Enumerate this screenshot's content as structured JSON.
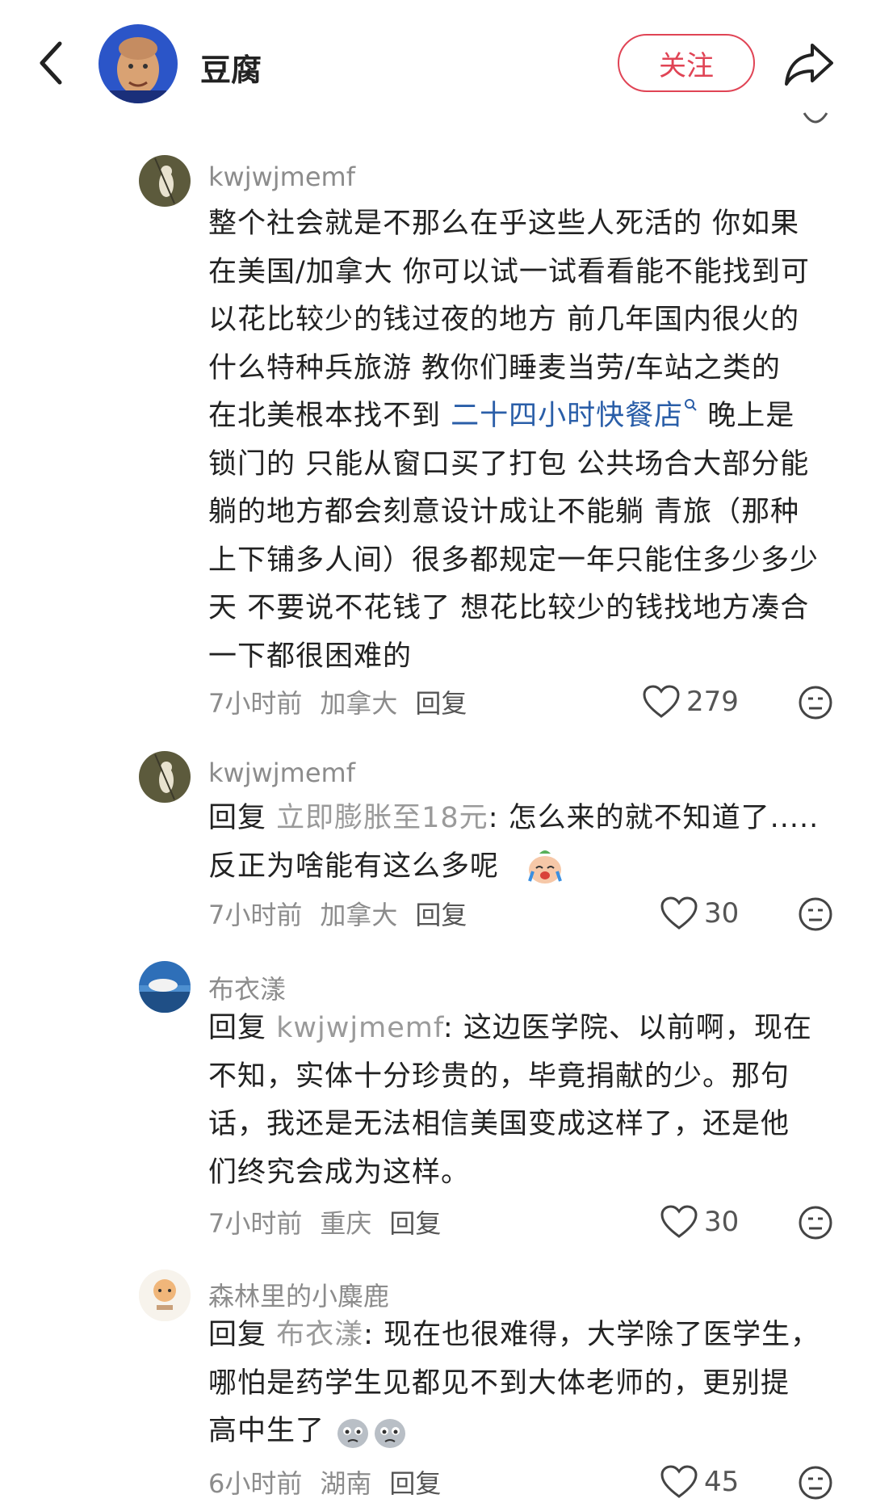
{
  "header": {
    "title": "豆腐",
    "follow_label": "关注"
  },
  "comments": [
    {
      "user": "kwjwjmemf",
      "text_lines": [
        "整个社会就是不那么在乎这些人死活的 你如果",
        "在美国/加拿大 你可以试一试看看能不能找到可",
        "以花比较少的钱过夜的地方 前几年国内很火的",
        "什么特种兵旅游 教你们睡麦当劳/车站之类的"
      ],
      "line5_before": "在北美根本找不到 ",
      "line5_link": "二十四小时快餐店",
      "line5_after": " 晚上是",
      "text_lines_2": [
        "锁门的 只能从窗口买了打包 公共场合大部分能",
        "躺的地方都会刻意设计成让不能躺 青旅（那种",
        "上下铺多人间）很多都规定一年只能住多少多少",
        "天 不要说不花钱了 想花比较少的钱找地方凑合",
        "一下都很困难的"
      ],
      "time": "7小时前",
      "location": "加拿大",
      "reply_label": "回复",
      "likes": "279"
    },
    {
      "user": "kwjwjmemf",
      "reply_prefix": "回复 ",
      "reply_to": "立即膨胀至18元",
      "text_line1": ": 怎么来的就不知道了.....",
      "text_line2": "反正为啥能有这么多呢",
      "time": "7小时前",
      "location": "加拿大",
      "reply_label": "回复",
      "likes": "30"
    },
    {
      "user": "布衣漾",
      "reply_prefix": "回复 ",
      "reply_to": "kwjwjmemf",
      "text_line1": ": 这边医学院、以前啊，现在",
      "text_lines": [
        "不知，实体十分珍贵的，毕竟捐献的少。那句",
        "话，我还是无法相信美国变成这样了，还是他",
        "们终究会成为这样。"
      ],
      "time": "7小时前",
      "location": "重庆",
      "reply_label": "回复",
      "likes": "30"
    },
    {
      "user": "森林里的小麋鹿",
      "reply_prefix": "回复 ",
      "reply_to": "布衣漾",
      "text_line1": ": 现在也很难得，大学除了医学生，",
      "text_lines": [
        "哪怕是药学生见都见不到大体老师的，更别提"
      ],
      "text_line_last": "高中生了",
      "time": "6小时前",
      "location": "湖南",
      "reply_label": "回复",
      "likes": "45"
    }
  ],
  "colors": {
    "accent": "#e04455",
    "link": "#2a5ea8",
    "muted": "#8c8c8c"
  }
}
